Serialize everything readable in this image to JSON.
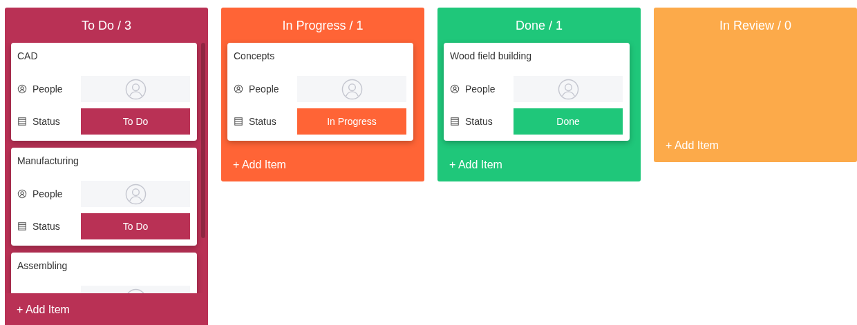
{
  "columns": [
    {
      "title": "To Do / 3",
      "color": "#b93155",
      "add_label": "+ Add Item",
      "scrollable": true,
      "cards": [
        {
          "title": "CAD",
          "fields": [
            {
              "kind": "people",
              "label": "People"
            },
            {
              "kind": "status",
              "label": "Status",
              "value": "To Do"
            }
          ]
        },
        {
          "title": "Manufacturing",
          "fields": [
            {
              "kind": "people",
              "label": "People"
            },
            {
              "kind": "status",
              "label": "Status",
              "value": "To Do"
            }
          ]
        },
        {
          "title": "Assembling",
          "fields": [
            {
              "kind": "people"
            }
          ]
        }
      ]
    },
    {
      "title": "In Progress / 1",
      "color": "#ff6436",
      "add_label": "+ Add Item",
      "scrollable": false,
      "cards": [
        {
          "title": "Concepts",
          "fields": [
            {
              "kind": "people",
              "label": "People"
            },
            {
              "kind": "status",
              "label": "Status",
              "value": "In Progress"
            }
          ]
        }
      ]
    },
    {
      "title": "Done / 1",
      "color": "#1fc77a",
      "add_label": "+ Add Item",
      "scrollable": false,
      "cards": [
        {
          "title": "Wood field building",
          "fields": [
            {
              "kind": "people",
              "label": "People"
            },
            {
              "kind": "status",
              "label": "Status",
              "value": "Done"
            }
          ]
        }
      ]
    },
    {
      "title": "In Review / 0",
      "color": "#fcaa4a",
      "add_label": "+ Add Item",
      "scrollable": false
    }
  ]
}
